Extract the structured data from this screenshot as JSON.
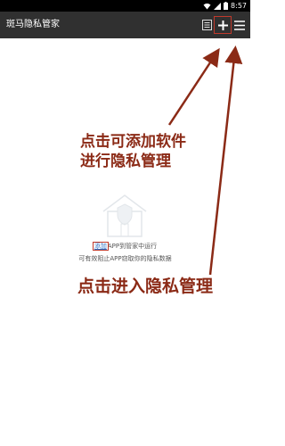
{
  "status_bar": {
    "time": "8:57",
    "icons": [
      "wifi-icon",
      "signal-icon",
      "battery-icon"
    ]
  },
  "toolbar": {
    "title": "斑马隐私管家",
    "actions": [
      "document-icon",
      "add-icon",
      "menu-icon"
    ]
  },
  "empty_state": {
    "link_text": "添加",
    "line1_rest": "APP到管家中运行",
    "line2": "可有效阻止APP窃取你的隐私数据"
  },
  "annotations": {
    "add_hint_line1": "点击可添加软件",
    "add_hint_line2": "进行隐私管理",
    "enter_hint": "点击进入隐私管理"
  },
  "colors": {
    "toolbar_bg": "#303030",
    "annotation": "#8b2a16",
    "link": "#2e6fc4"
  }
}
